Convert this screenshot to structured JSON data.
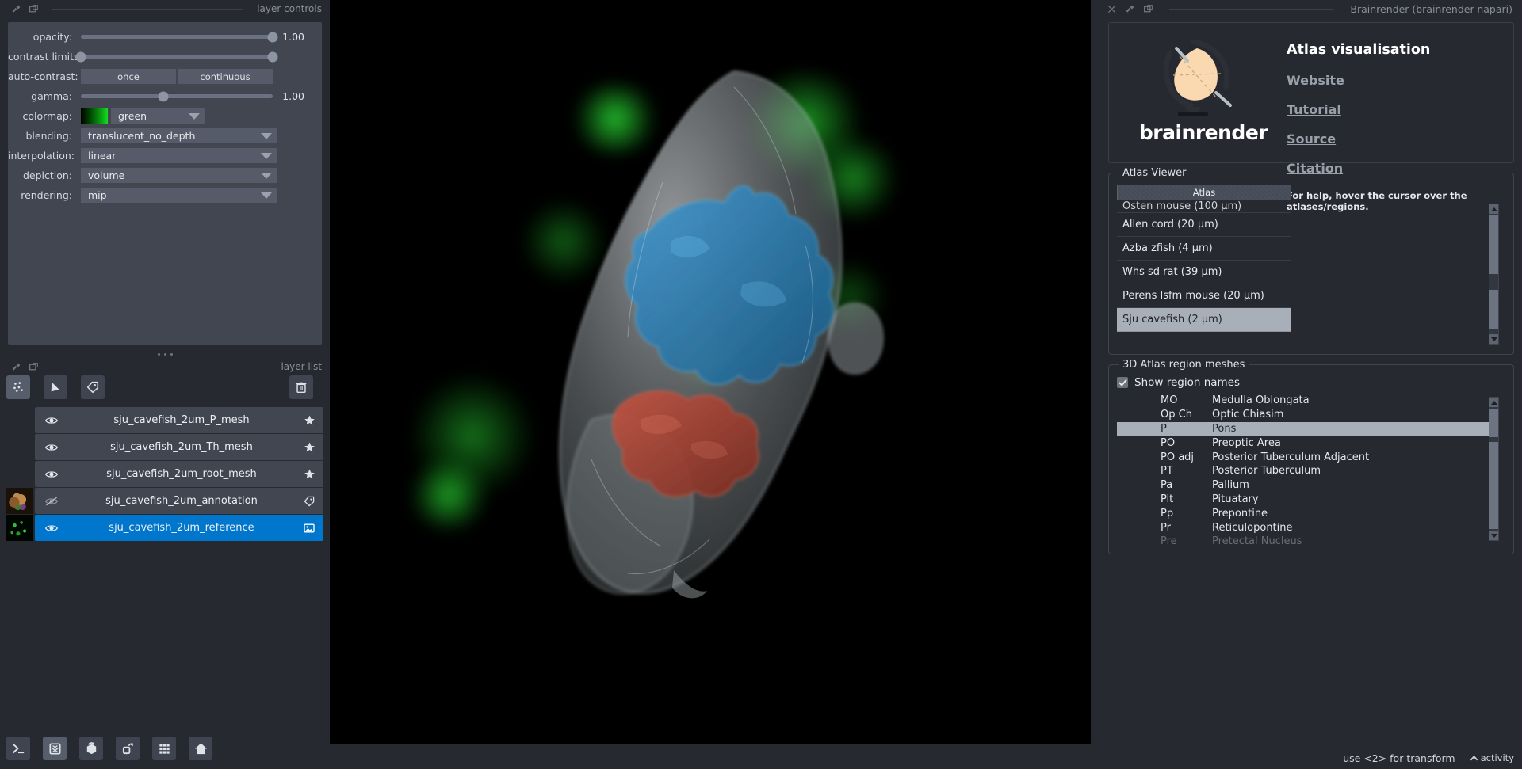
{
  "left_dock": {
    "title": "layer controls",
    "icons": [
      "float-icon",
      "popout-icon"
    ],
    "controls": {
      "opacity": {
        "label": "opacity:",
        "value": "1.00",
        "percent": 100
      },
      "contrast_limits": {
        "label": "contrast limits:",
        "low_percent": 0,
        "high_percent": 100
      },
      "auto_contrast": {
        "label": "auto-contrast:",
        "once": "once",
        "continuous": "continuous"
      },
      "gamma": {
        "label": "gamma:",
        "value": "1.00",
        "percent": 43
      },
      "colormap": {
        "label": "colormap:",
        "value": "green"
      },
      "blending": {
        "label": "blending:",
        "value": "translucent_no_depth"
      },
      "interpolation": {
        "label": "interpolation:",
        "value": "linear"
      },
      "depiction": {
        "label": "depiction:",
        "value": "volume"
      },
      "rendering": {
        "label": "rendering:",
        "value": "mip"
      }
    }
  },
  "layer_list": {
    "title": "layer list",
    "tools": [
      {
        "name": "points-layer-button",
        "icon": "points-icon",
        "selected": true
      },
      {
        "name": "shapes-layer-button",
        "icon": "shapes-icon",
        "selected": false
      },
      {
        "name": "labels-layer-button",
        "icon": "tag-icon",
        "selected": false
      }
    ],
    "delete_button": {
      "name": "delete-layer-button",
      "icon": "trash-icon"
    },
    "rows": [
      {
        "name": "sju_cavefish_2um_P_mesh",
        "visible": true,
        "selected": false,
        "type_icon": "star-icon",
        "thumb": "none"
      },
      {
        "name": "sju_cavefish_2um_Th_mesh",
        "visible": true,
        "selected": false,
        "type_icon": "star-icon",
        "thumb": "none"
      },
      {
        "name": "sju_cavefish_2um_root_mesh",
        "visible": true,
        "selected": false,
        "type_icon": "star-icon",
        "thumb": "none"
      },
      {
        "name": "sju_cavefish_2um_annotation",
        "visible": false,
        "selected": false,
        "type_icon": "tag-icon",
        "thumb": "anno"
      },
      {
        "name": "sju_cavefish_2um_reference",
        "visible": true,
        "selected": true,
        "type_icon": "image-icon",
        "thumb": "ref"
      }
    ]
  },
  "bottom_tools": [
    {
      "name": "console-button",
      "icon": "terminal-icon"
    },
    {
      "name": "ndisplay-2d-button",
      "icon": "square-3d-icon",
      "selected": true
    },
    {
      "name": "roll-dims-button",
      "icon": "roll-cube-icon"
    },
    {
      "name": "transpose-button",
      "icon": "transpose-icon"
    },
    {
      "name": "grid-view-button",
      "icon": "grid-icon"
    },
    {
      "name": "home-button",
      "icon": "home-icon"
    }
  ],
  "right_dock": {
    "title": "Brainrender (brainrender-napari)",
    "icons": [
      "close-icon",
      "float-icon",
      "popout-icon"
    ]
  },
  "brand": {
    "wordmark": "brainrender",
    "heading": "Atlas visualisation",
    "links": [
      "Website",
      "Tutorial",
      "Source",
      "Citation"
    ],
    "help_text": "For help, hover the cursor over the atlases/regions."
  },
  "atlas_viewer": {
    "group_title": "Atlas Viewer",
    "column_header": "Atlas",
    "items": [
      {
        "label": "Osten mouse (100 µm)",
        "selected": false,
        "clipped": true
      },
      {
        "label": "Allen cord (20 µm)",
        "selected": false
      },
      {
        "label": "Azba zfish (4 µm)",
        "selected": false
      },
      {
        "label": "Whs sd rat (39 µm)",
        "selected": false
      },
      {
        "label": "Perens lsfm mouse (20 µm)",
        "selected": false
      },
      {
        "label": "Sju cavefish (2 µm)",
        "selected": true
      }
    ]
  },
  "region_meshes": {
    "group_title": "3D Atlas region meshes",
    "show_region_names": {
      "label": "Show region names",
      "checked": true
    },
    "rows": [
      {
        "abbr": "MO",
        "name": "Medulla Oblongata",
        "selected": false
      },
      {
        "abbr": "Op Ch",
        "name": "Optic Chiasim",
        "selected": false
      },
      {
        "abbr": "P",
        "name": "Pons",
        "selected": true
      },
      {
        "abbr": "PO",
        "name": "Preoptic Area",
        "selected": false
      },
      {
        "abbr": "PO adj",
        "name": "Posterior Tuberculum Adjacent",
        "selected": false
      },
      {
        "abbr": "PT",
        "name": "Posterior Tuberculum",
        "selected": false
      },
      {
        "abbr": "Pa",
        "name": "Pallium",
        "selected": false
      },
      {
        "abbr": "Pit",
        "name": "Pituatary",
        "selected": false
      },
      {
        "abbr": "Pp",
        "name": "Prepontine",
        "selected": false
      },
      {
        "abbr": "Pr",
        "name": "Reticulopontine",
        "selected": false
      },
      {
        "abbr": "Pre",
        "name": "Pretectal Nucleus",
        "selected": false
      }
    ]
  },
  "status": {
    "hint": "use <2> for transform",
    "activity": "activity"
  },
  "colors": {
    "accent": "#0077cc",
    "panel_bg": "#262930",
    "control_bg": "#414651",
    "selection_grey": "#a9afb9",
    "colormap_green": "#14dd1e",
    "mesh_blue": "#2a7fb8",
    "mesh_red": "#b0402f"
  }
}
